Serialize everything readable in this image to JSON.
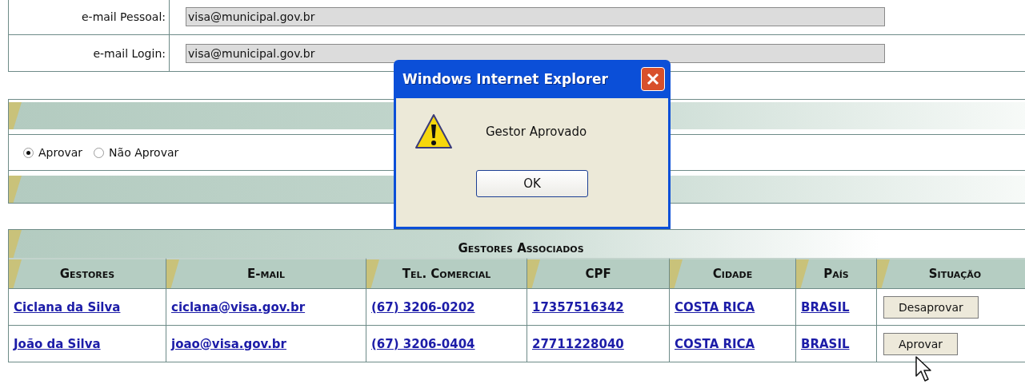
{
  "form": {
    "fields": [
      {
        "label": "e-mail Pessoal:",
        "value": "visa@municipal.gov.br"
      },
      {
        "label": "e-mail Login:",
        "value": "visa@municipal.gov.br"
      }
    ]
  },
  "approval": {
    "options": [
      {
        "label": "Aprovar",
        "selected": true
      },
      {
        "label": "Não Aprovar",
        "selected": false
      }
    ]
  },
  "table": {
    "title": "Gestores Associados",
    "columns": [
      "Gestores",
      "E-mail",
      "Tel. Comercial",
      "CPF",
      "Cidade",
      "País",
      "Situação"
    ],
    "rows": [
      {
        "cells": [
          "Ciclana da Silva",
          "ciclana@visa.gov.br",
          "(67) 3206-0202",
          "17357516342",
          "COSTA RICA",
          "BRASIL"
        ],
        "action": "Desaprovar"
      },
      {
        "cells": [
          "João da Silva",
          "joao@visa.gov.br",
          "(67) 3206-0404",
          "27711228040",
          "COSTA RICA",
          "BRASIL"
        ],
        "action": "Aprovar"
      }
    ]
  },
  "dialog": {
    "title": "Windows Internet Explorer",
    "message": "Gestor Aprovado",
    "button": "OK"
  }
}
